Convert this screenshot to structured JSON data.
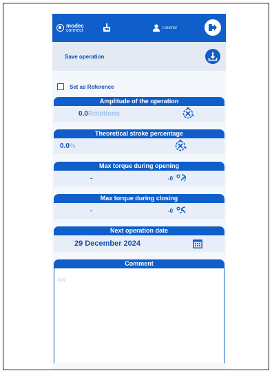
{
  "header": {
    "logo_line1": "modec",
    "logo_line2": "connect",
    "username": "t.michel"
  },
  "save": {
    "label": "Save operation"
  },
  "reference": {
    "label": "Set as Reference",
    "checked": false
  },
  "amplitude": {
    "title": "Amplitude of the operation",
    "value": "0.0",
    "unit": "Rotations"
  },
  "stroke": {
    "title": "Theoretical stroke percentage",
    "value": "0.0",
    "unit": "%"
  },
  "torque_open": {
    "title": "Max torque during opening",
    "value": "-",
    "reading": "-0"
  },
  "torque_close": {
    "title": "Max torque during closing",
    "value": "-",
    "reading": "-0"
  },
  "next_date": {
    "title": "Next operation date",
    "value": "29 December 2024"
  },
  "comment": {
    "title": "Comment",
    "placeholder": "xxx"
  },
  "colors": {
    "primary": "#0f5ec9",
    "light_bg": "#e8eef7",
    "unit_light": "#9dc1ee"
  }
}
